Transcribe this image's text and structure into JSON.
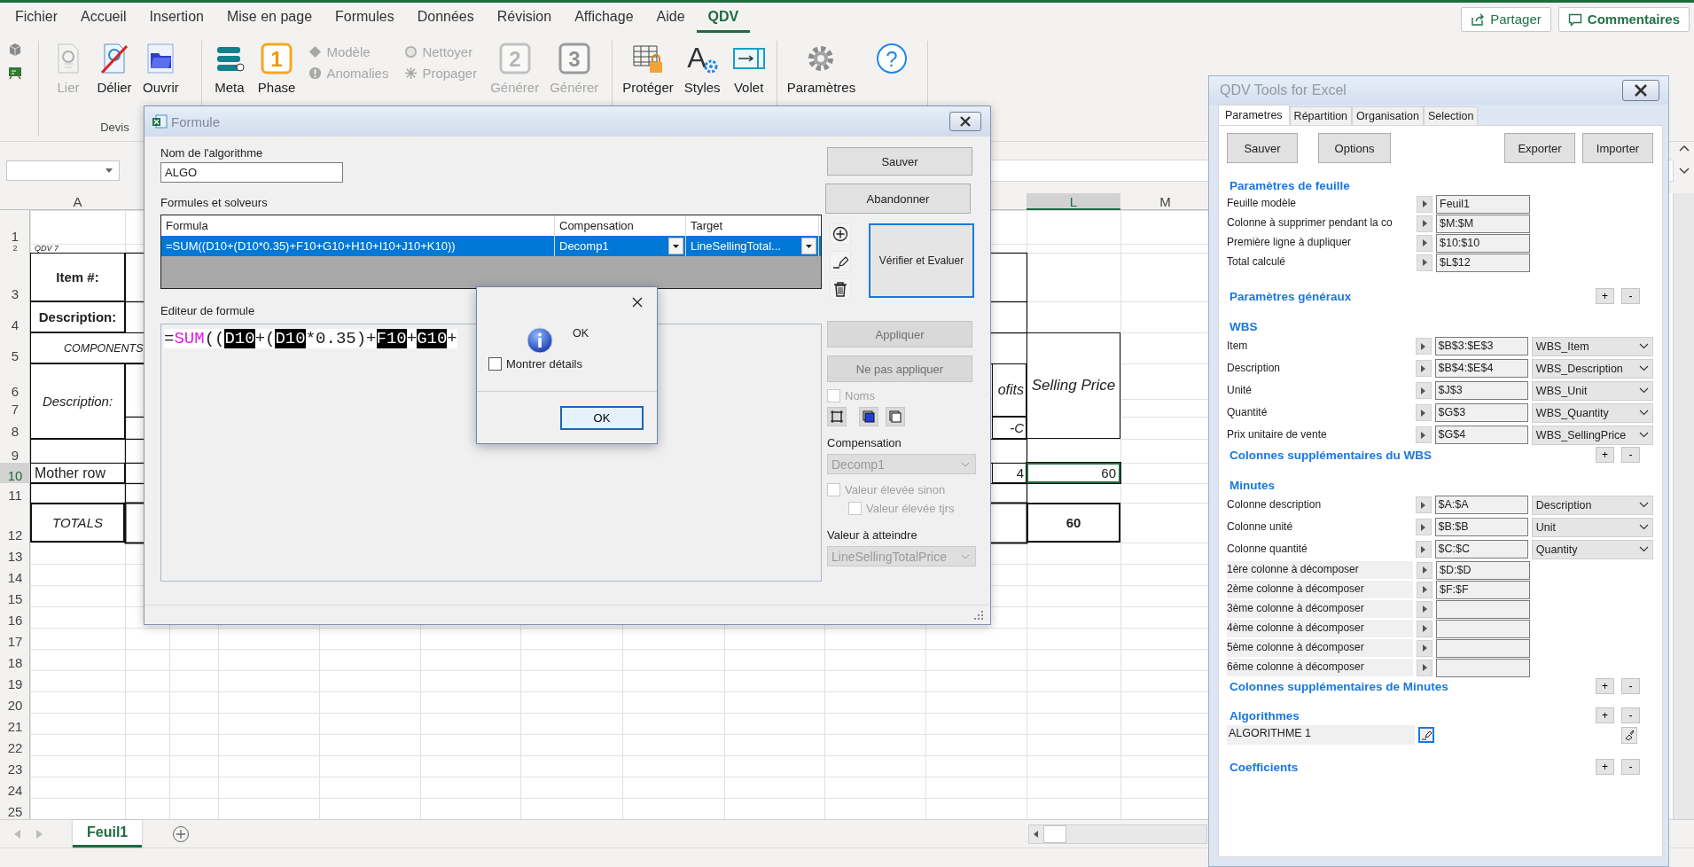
{
  "menu_tabs": [
    {
      "label": "Fichier",
      "selected": false
    },
    {
      "label": "Accueil",
      "selected": false
    },
    {
      "label": "Insertion",
      "selected": false
    },
    {
      "label": "Mise en page",
      "selected": false
    },
    {
      "label": "Formules",
      "selected": false
    },
    {
      "label": "Données",
      "selected": false
    },
    {
      "label": "Révision",
      "selected": false
    },
    {
      "label": "Affichage",
      "selected": false
    },
    {
      "label": "Aide",
      "selected": false
    },
    {
      "label": "QDV",
      "selected": true
    }
  ],
  "share_button": "Partager",
  "comments_button": "Commentaires",
  "ribbon": {
    "groups": [
      {
        "label": "Devis",
        "items": [
          {
            "kind": "large",
            "label": "Lier",
            "disabled": true
          },
          {
            "kind": "large",
            "label": "Délier",
            "disabled": false
          },
          {
            "kind": "large",
            "label": "Ouvrir",
            "disabled": false
          }
        ]
      },
      {
        "items": [
          {
            "kind": "large",
            "label": "Meta",
            "disabled": false
          },
          {
            "kind": "large",
            "label": "Phase",
            "glyph": "1",
            "disabled": false
          },
          {
            "kind": "stack",
            "items": [
              {
                "label": "Modèle",
                "disabled": true
              },
              {
                "label": "Anomalies",
                "disabled": true
              }
            ]
          },
          {
            "kind": "stack",
            "items": [
              {
                "label": "Nettoyer",
                "disabled": true
              },
              {
                "label": "Propager",
                "disabled": true
              }
            ]
          },
          {
            "kind": "large",
            "label": "Générer",
            "glyph": "2",
            "disabled": true
          },
          {
            "kind": "large",
            "label": "Générer",
            "glyph": "3",
            "disabled": true
          }
        ]
      },
      {
        "items": [
          {
            "kind": "large",
            "label": "Protéger",
            "disabled": false
          },
          {
            "kind": "large",
            "label": "Styles",
            "glyph": "A",
            "disabled": false
          },
          {
            "kind": "large",
            "label": "Volet",
            "disabled": false
          }
        ]
      },
      {
        "items": [
          {
            "kind": "large",
            "label": "Paramètres",
            "disabled": false
          },
          {
            "kind": "round",
            "glyph": "?",
            "disabled": false
          }
        ]
      }
    ]
  },
  "sheet": {
    "column_headers": [
      "A",
      "L",
      "M"
    ],
    "row_headers": [
      "1",
      "2",
      "3",
      "4",
      "5",
      "6",
      "7",
      "8",
      "9",
      "10",
      "11",
      "12",
      "13",
      "14",
      "15",
      "16",
      "17",
      "18",
      "19",
      "20",
      "21",
      "22",
      "23",
      "24",
      "25"
    ],
    "cells": [
      {
        "text": "QDV 7",
        "selected": false
      },
      {
        "text": "Item #:",
        "selected": false
      },
      {
        "text": "Description:",
        "selected": false
      },
      {
        "text": "COMPONENTS",
        "selected": false
      },
      {
        "text": "Description:",
        "selected": false
      },
      {
        "text": "Mother row",
        "selected": false
      },
      {
        "text": "TOTALS",
        "selected": false
      },
      {
        "text": "ofits",
        "selected": false
      },
      {
        "text": "-C",
        "selected": false
      },
      {
        "text": "4",
        "selected": false
      },
      {
        "text": "Selling Price",
        "selected": false
      },
      {
        "text": "60",
        "selected": true
      },
      {
        "text": "60",
        "selected": false
      }
    ],
    "tab": {
      "label": "Feuil1",
      "selected": true
    }
  },
  "formula_dialog": {
    "title": "Formule",
    "name_label": "Nom de l'algorithme",
    "name_value": "ALGO",
    "formulas_label": "Formules et solveurs",
    "columns": [
      "Formula",
      "Compensation",
      "Target"
    ],
    "rows": [
      {
        "formula": "=SUM((D10+(D10*0.35)+F10+G10+H10+I10+J10+K10))",
        "compensation": "Decomp1",
        "target": "LineSellingTotal...",
        "selected": true
      }
    ],
    "save_button": "Sauver",
    "cancel_button": "Abandonner",
    "verify_button": "Vérifier et Evaluer",
    "editor_label": "Editeur de formule",
    "editor_tokens": [
      {
        "text": "=",
        "kind": "plain"
      },
      {
        "text": "SUM",
        "kind": "function"
      },
      {
        "text": "((",
        "kind": "plain"
      },
      {
        "text": "D10",
        "kind": "reference"
      },
      {
        "text": "+(",
        "kind": "plain"
      },
      {
        "text": "D10",
        "kind": "reference"
      },
      {
        "text": "*0.35)+",
        "kind": "plain"
      },
      {
        "text": "F10",
        "kind": "reference"
      },
      {
        "text": "+",
        "kind": "plain"
      },
      {
        "text": "G10",
        "kind": "reference"
      },
      {
        "text": "+",
        "kind": "plain"
      }
    ],
    "apply_button": {
      "label": "Appliquer",
      "disabled": true
    },
    "discard_button": {
      "label": "Ne pas appliquer",
      "disabled": true
    },
    "names_checkbox": {
      "label": "Noms",
      "checked": false,
      "disabled": true
    },
    "compensation_label": "Compensation",
    "compensation_combo": {
      "value": "Decomp1",
      "disabled": true
    },
    "high_else_checkbox": {
      "label": "Valeur élevée sinon",
      "checked": false,
      "disabled": true
    },
    "high_always_checkbox": {
      "label": "Valeur élevée tjrs",
      "checked": false,
      "disabled": true
    },
    "target_label": "Valeur à atteindre",
    "target_combo": {
      "value": "LineSellingTotalPrice",
      "disabled": true
    }
  },
  "message_box": {
    "message": "OK",
    "details_checkbox": {
      "label": "Montrer détails",
      "checked": false
    },
    "ok_button": "OK"
  },
  "side_panel": {
    "title": "QDV Tools for Excel",
    "tabs": [
      {
        "label": "Parametres",
        "selected": true
      },
      {
        "label": "Répartition",
        "selected": false
      },
      {
        "label": "Organisation",
        "selected": false
      },
      {
        "label": "Selection",
        "selected": false
      }
    ],
    "buttons": [
      "Sauver",
      "Options",
      "Exporter",
      "Importer"
    ],
    "sections": [
      {
        "title": "Paramètres de feuille",
        "rows": [
          {
            "kind": "field",
            "label": "Feuille modèle",
            "value": "Feuil1",
            "shaded": false
          },
          {
            "kind": "field",
            "label": "Colonne à supprimer pendant la co",
            "value": "$M:$M",
            "shaded": false
          },
          {
            "kind": "field",
            "label": "Première ligne à dupliquer",
            "value": "$10:$10",
            "shaded": false
          },
          {
            "kind": "field",
            "label": "Total calculé",
            "value": "$L$12",
            "shaded": false
          }
        ]
      },
      {
        "title": "Paramètres généraux",
        "add": "+",
        "remove": "-"
      },
      {
        "title": "WBS",
        "rows": [
          {
            "kind": "field",
            "label": "Item",
            "value": "$B$3:$E$3",
            "combo": "WBS_Item",
            "shaded": false
          },
          {
            "kind": "field",
            "label": "Description",
            "value": "$B$4:$E$4",
            "combo": "WBS_Description",
            "shaded": false
          },
          {
            "kind": "field",
            "label": "Unité",
            "value": "$J$3",
            "combo": "WBS_Unit",
            "shaded": false
          },
          {
            "kind": "field",
            "label": "Quantité",
            "value": "$G$3",
            "combo": "WBS_Quantity",
            "shaded": false
          },
          {
            "kind": "field",
            "label": "Prix unitaire de vente",
            "value": "$G$4",
            "combo": "WBS_SellingPrice",
            "shaded": false
          }
        ]
      },
      {
        "title": "Colonnes supplémentaires du WBS",
        "add": "+",
        "remove": "-"
      },
      {
        "title": "Minutes",
        "rows": [
          {
            "kind": "field",
            "label": "Colonne description",
            "value": "$A:$A",
            "combo": "Description",
            "shaded": false
          },
          {
            "kind": "field",
            "label": "Colonne unité",
            "value": "$B:$B",
            "combo": "Unit",
            "shaded": false
          },
          {
            "kind": "field",
            "label": "Colonne quantité",
            "value": "$C:$C",
            "combo": "Quantity",
            "shaded": false
          },
          {
            "kind": "field",
            "label": "1ère colonne à décomposer",
            "value": "$D:$D",
            "shaded": true
          },
          {
            "kind": "field",
            "label": "2ème colonne à décomposer",
            "value": "$F:$F",
            "shaded": true
          },
          {
            "kind": "field",
            "label": "3ème colonne à décomposer",
            "shaded": true
          },
          {
            "kind": "field",
            "label": "4ème colonne à décomposer",
            "shaded": true
          },
          {
            "kind": "field",
            "label": "5ème colonne à décomposer",
            "shaded": true
          },
          {
            "kind": "field",
            "label": "6ème colonne à décomposer",
            "shaded": true
          }
        ]
      },
      {
        "title": "Colonnes supplémentaires de Minutes",
        "add": "+",
        "remove": "-"
      },
      {
        "title": "Algorithmes",
        "add": "+",
        "remove": "-",
        "rows": [
          {
            "kind": "algorithm",
            "label": "ALGORITHME 1"
          }
        ]
      },
      {
        "title": "Coefficients",
        "add": "+",
        "remove": "-"
      }
    ]
  }
}
